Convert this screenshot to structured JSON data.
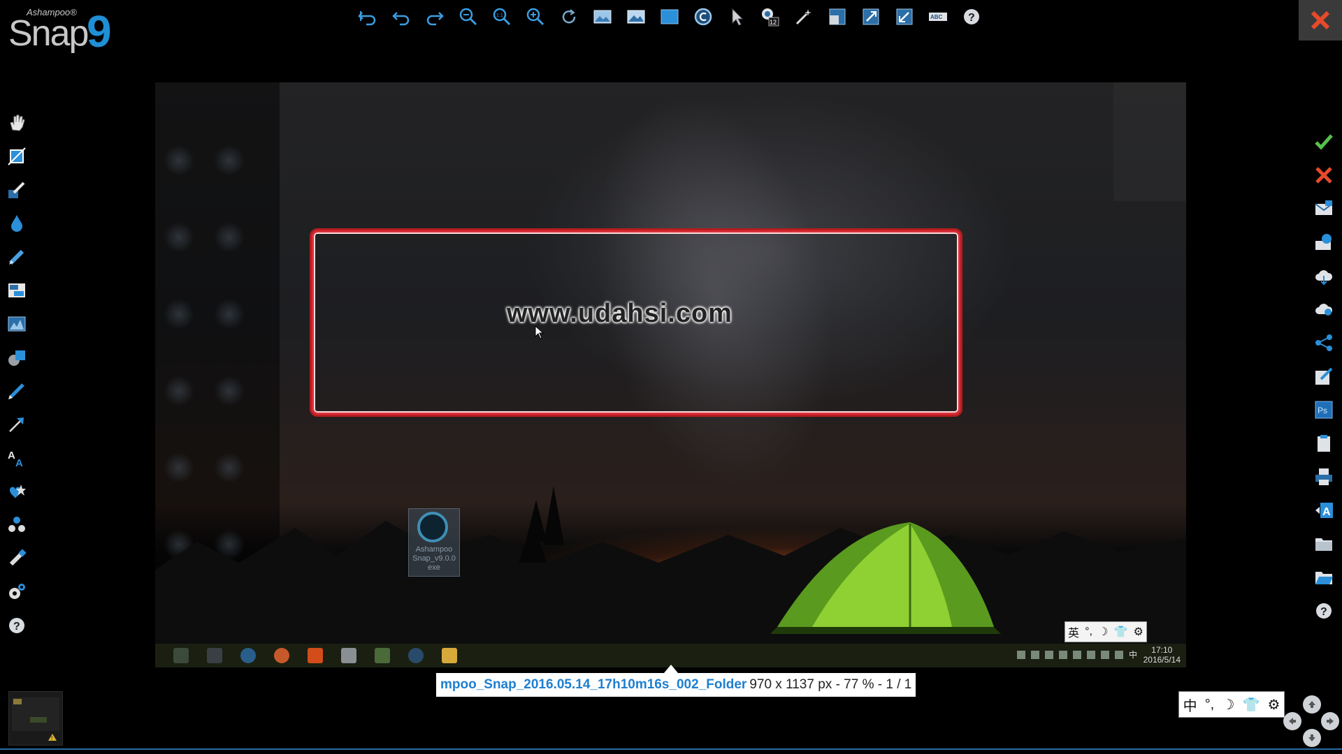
{
  "app": {
    "brand": "Ashampoo®",
    "name": "Snap",
    "version": "9"
  },
  "top_toolbar": [
    {
      "name": "undo-all",
      "icon": "undo-all-icon"
    },
    {
      "name": "undo",
      "icon": "undo-icon"
    },
    {
      "name": "redo",
      "icon": "redo-icon"
    },
    {
      "name": "zoom-out",
      "icon": "zoom-out-icon"
    },
    {
      "name": "zoom-actual",
      "icon": "zoom-actual-icon"
    },
    {
      "name": "zoom-in",
      "icon": "zoom-in-icon"
    },
    {
      "name": "rotate",
      "icon": "rotate-icon"
    },
    {
      "name": "image-effects",
      "icon": "image-effects-icon"
    },
    {
      "name": "image-adjust",
      "icon": "image-adjust-icon"
    },
    {
      "name": "canvas",
      "icon": "canvas-icon"
    },
    {
      "name": "watermark",
      "icon": "copyright-icon"
    },
    {
      "name": "select",
      "icon": "pointer-icon"
    },
    {
      "name": "numbering",
      "icon": "numbering-icon",
      "badge": "12"
    },
    {
      "name": "magic-wand",
      "icon": "magic-wand-icon"
    },
    {
      "name": "resize",
      "icon": "resize-icon"
    },
    {
      "name": "expand",
      "icon": "expand-icon"
    },
    {
      "name": "shrink",
      "icon": "shrink-icon"
    },
    {
      "name": "ocr",
      "icon": "abc-icon",
      "label": "ABC"
    },
    {
      "name": "help",
      "icon": "help-icon"
    }
  ],
  "left_toolbar": [
    "hand-icon",
    "crop-icon",
    "pen-blur-icon",
    "drop-icon",
    "highlighter-icon",
    "layout-icon",
    "chart-icon",
    "shapes-icon",
    "pencil-icon",
    "arrow-icon",
    "text-icon",
    "stamp-icon",
    "numbers-icon",
    "marker-icon",
    "settings-icon",
    "help-icon"
  ],
  "right_toolbar": [
    "checkmark-icon",
    "cancel-icon",
    "email-icon",
    "web-send-icon",
    "cloud-icon",
    "cloud-upload-icon",
    "share-icon",
    "edit-external-icon",
    "photoshop-icon",
    "clipboard-icon",
    "print-icon",
    "export-text-icon",
    "folder-icon",
    "open-folder-icon",
    "help-icon"
  ],
  "canvas": {
    "watermark_text": "www.udahsi.com",
    "desktop_icon_label": "Ashampoo Snap_v9.0.0 exe",
    "taskbar_time": "17:10",
    "taskbar_date": "2016/5/14",
    "ime_small": [
      "英",
      "°,",
      "☽",
      "👕",
      "⚙"
    ],
    "tray_ime": "中"
  },
  "status": {
    "file": "mpoo_Snap_2016.05.14_17h10m16s_002_Folder",
    "info": "970 x 1137 px - 77 % - 1 / 1"
  },
  "ime_box": [
    "中",
    "°,",
    "☽",
    "👕",
    "⚙"
  ],
  "colors": {
    "accent": "#1f8fd6",
    "close_red": "#e74a2b",
    "selection_red": "#d8303c"
  }
}
